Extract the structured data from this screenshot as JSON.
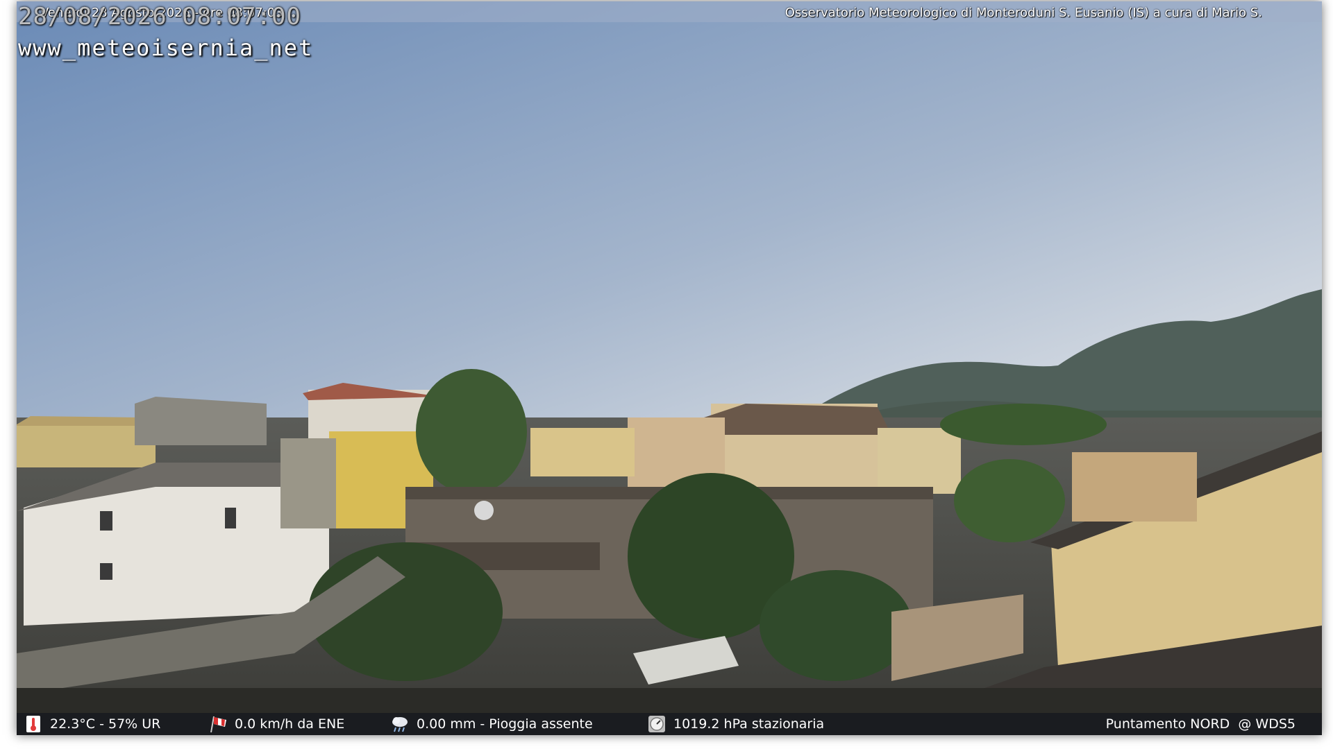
{
  "overlay": {
    "camera_timestamp": "28/08/2026 08:07:00",
    "site_watermark": "www_meteoisernia_net",
    "top_date_line": "Venerdì 28 Agosto 2026 - ore 08:07:03",
    "observatory": "Osservatorio Meteorologico di Monteroduni S. Eusanio (IS) a cura di Mario S."
  },
  "weather_bar": {
    "temperature_humidity": {
      "icon": "thermometer-icon",
      "text": "22.3°C - 57% UR",
      "accent": "#e23b3b"
    },
    "wind": {
      "icon": "windsock-icon",
      "text": "0.0 km/h da ENE",
      "accent": "#d93030"
    },
    "rain": {
      "icon": "rain-cloud-icon",
      "text": "0.00 mm - Pioggia assente"
    },
    "pressure": {
      "icon": "barometer-icon",
      "text": "1019.2 hPa stazionaria"
    },
    "pointing": {
      "text": "Puntamento NORD  @ WDS5"
    }
  },
  "colors": {
    "sky_top": "#6c8db8",
    "sky_horizon": "#cdd6e2",
    "mountain": "#4d5a55",
    "bar_bg": "#14161e"
  }
}
